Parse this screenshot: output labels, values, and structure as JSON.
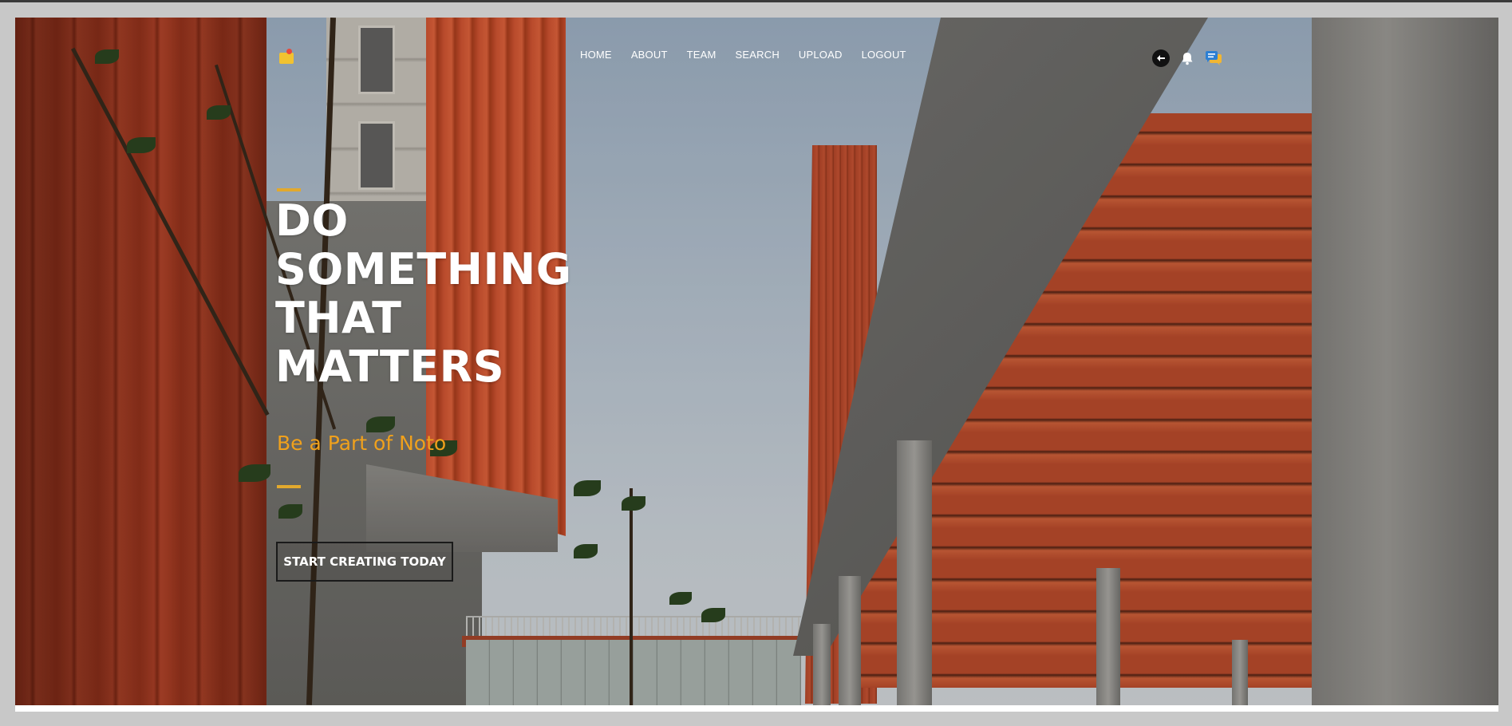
{
  "header": {
    "logo_icon": "folder-logo-icon",
    "nav": [
      {
        "label": "HOME"
      },
      {
        "label": "ABOUT"
      },
      {
        "label": "TEAM"
      },
      {
        "label": "SEARCH"
      },
      {
        "label": "UPLOAD"
      },
      {
        "label": "LOGOUT"
      }
    ],
    "icons": [
      "avatar",
      "bell-icon",
      "chat-icon"
    ]
  },
  "hero": {
    "headline_lines": [
      "DO",
      "SOMETHING",
      "THAT",
      "MATTERS"
    ],
    "subheading": "Be a Part of Noto",
    "cta_label": "START CREATING TODAY",
    "background_image": "architecture-photo-red-buildings"
  },
  "colors": {
    "accent": "#e2a92d",
    "subheading": "#f0a11c",
    "nav_text": "#ffffff",
    "headline_text": "#ffffff"
  }
}
